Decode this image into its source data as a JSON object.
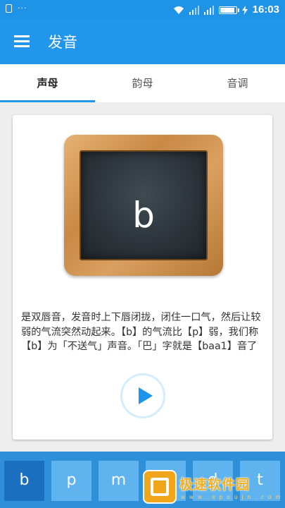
{
  "status_bar": {
    "time": "16:03",
    "left_icons": [
      "sim-lock-icon",
      "more-dots-icon"
    ],
    "right_icons": [
      "wifi-icon",
      "signal-icon",
      "signal-icon",
      "battery-icon",
      "charging-icon"
    ]
  },
  "app_bar": {
    "menu_icon": "hamburger-menu-icon",
    "title": "发音"
  },
  "tabs": [
    {
      "label": "声母",
      "active": true
    },
    {
      "label": "韵母",
      "active": false
    },
    {
      "label": "音调",
      "active": false
    }
  ],
  "card": {
    "letter": "b",
    "description": "是双唇音，发音时上下唇闭拢，闭住一口气，然后让较弱的气流突然动起来。【b】的气流比【p】弱，我们称【b】为「不送气」声音。「巴」字就是【baa1】音了",
    "play_icon": "play-icon"
  },
  "letter_bar": {
    "keys": [
      {
        "label": "b",
        "active": true
      },
      {
        "label": "p",
        "active": false
      },
      {
        "label": "m",
        "active": false
      },
      {
        "label": "f",
        "active": false
      },
      {
        "label": "d",
        "active": false
      },
      {
        "label": "t",
        "active": false
      }
    ]
  },
  "watermark": {
    "text": "极速软件园",
    "url": "w w w . s p o u j n . c o m"
  },
  "colors": {
    "primary": "#2196eb",
    "status_bar": "#1f93e6",
    "key": "#5fb3ee",
    "key_active": "#1b6fc0",
    "bottom_bar": "#2e90d8"
  }
}
